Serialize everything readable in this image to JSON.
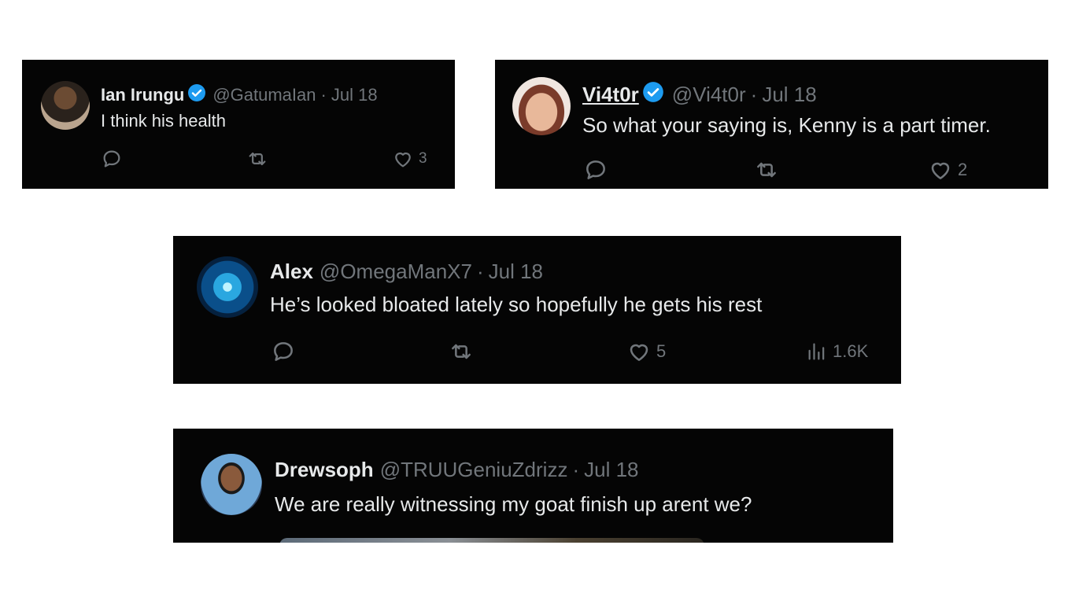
{
  "tweets": [
    {
      "name": "Ian Irungu",
      "handle": "@GatumaIan",
      "date": "Jul 18",
      "text": "I think his health",
      "likes": "3",
      "verified": true
    },
    {
      "name": "Vi4t0r",
      "handle": "@Vi4t0r",
      "date": "Jul 18",
      "text": "So what your saying is, Kenny is a part timer.",
      "likes": "2",
      "verified": true
    },
    {
      "name": "Alex",
      "handle": "@OmegaManX7",
      "date": "Jul 18",
      "text": "He’s looked bloated lately so hopefully he gets his rest",
      "likes": "5",
      "views": "1.6K",
      "verified": false
    },
    {
      "name": "Drewsoph",
      "handle": "@TRUUGeniuZdrizz",
      "date": "Jul 18",
      "text": "We are really witnessing my goat finish up arent we?",
      "verified": false
    }
  ],
  "separator": "·",
  "icons": [
    "reply-icon",
    "retweet-icon",
    "like-icon",
    "views-icon",
    "verified-badge-icon"
  ],
  "colors": {
    "card_bg": "#050505",
    "primary_text": "#e7e9ea",
    "secondary_text": "#71767b",
    "verified_blue": "#1d9bf0"
  }
}
